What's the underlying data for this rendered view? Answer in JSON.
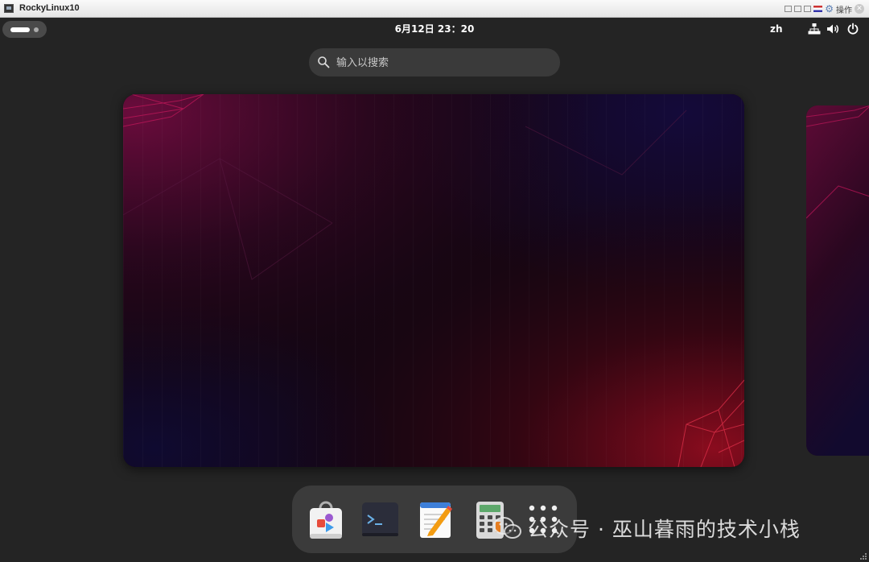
{
  "window": {
    "title": "RockyLinux10",
    "menu_label": "操作"
  },
  "panel": {
    "clock": "6月12日  23：20",
    "input_lang": "zh"
  },
  "search": {
    "placeholder": "输入以搜索"
  },
  "dash": {
    "apps": [
      {
        "name": "software-center"
      },
      {
        "name": "terminal"
      },
      {
        "name": "text-editor"
      },
      {
        "name": "calculator"
      },
      {
        "name": "show-apps"
      }
    ]
  },
  "watermark": {
    "text": "公众号 · 巫山暮雨的技术小栈"
  },
  "colors": {
    "panel_bg": "#242424",
    "search_bg": "#3a3a3a",
    "dash_bg": "#3b3b3b",
    "wallpaper_accent": "#8a0c2a"
  }
}
